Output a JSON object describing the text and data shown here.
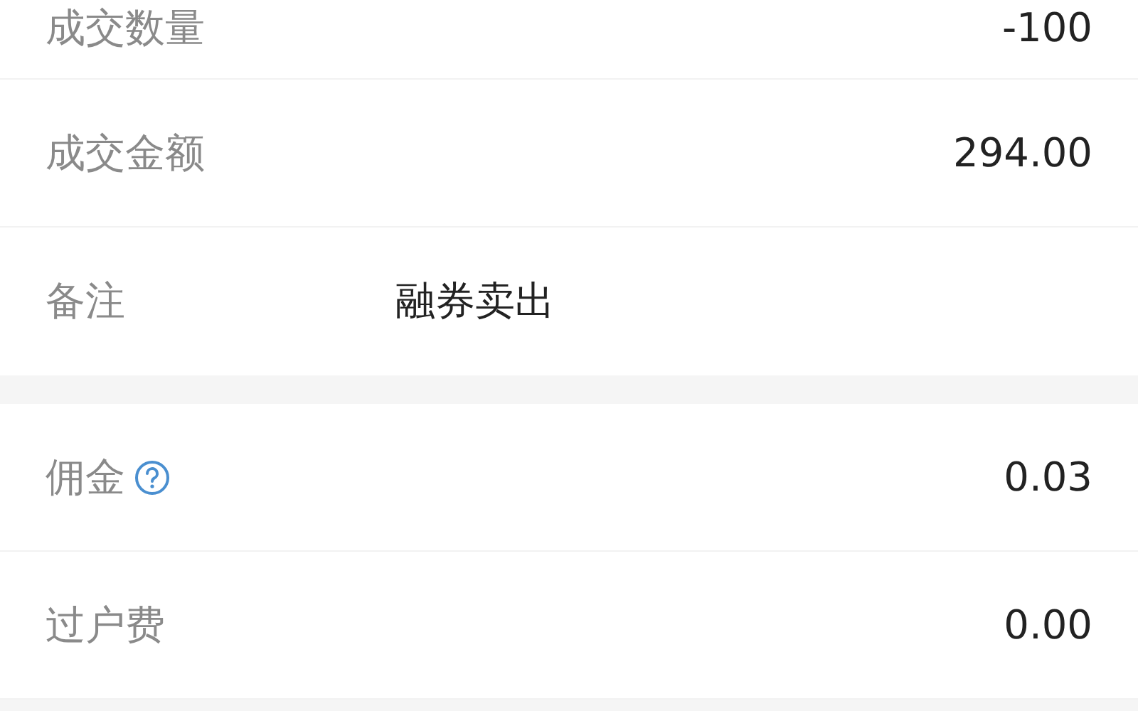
{
  "sections": [
    {
      "rows": [
        {
          "kind": "amount",
          "label": "成交数量",
          "value": "-100",
          "help": false
        },
        {
          "kind": "amount",
          "label": "成交金额",
          "value": "294.00",
          "help": false
        },
        {
          "kind": "note",
          "label": "备注",
          "value": "融券卖出",
          "help": false
        }
      ]
    },
    {
      "rows": [
        {
          "kind": "amount",
          "label": "佣金",
          "value": "0.03",
          "help": true
        },
        {
          "kind": "amount",
          "label": "过户费",
          "value": "0.00",
          "help": false
        }
      ]
    }
  ]
}
